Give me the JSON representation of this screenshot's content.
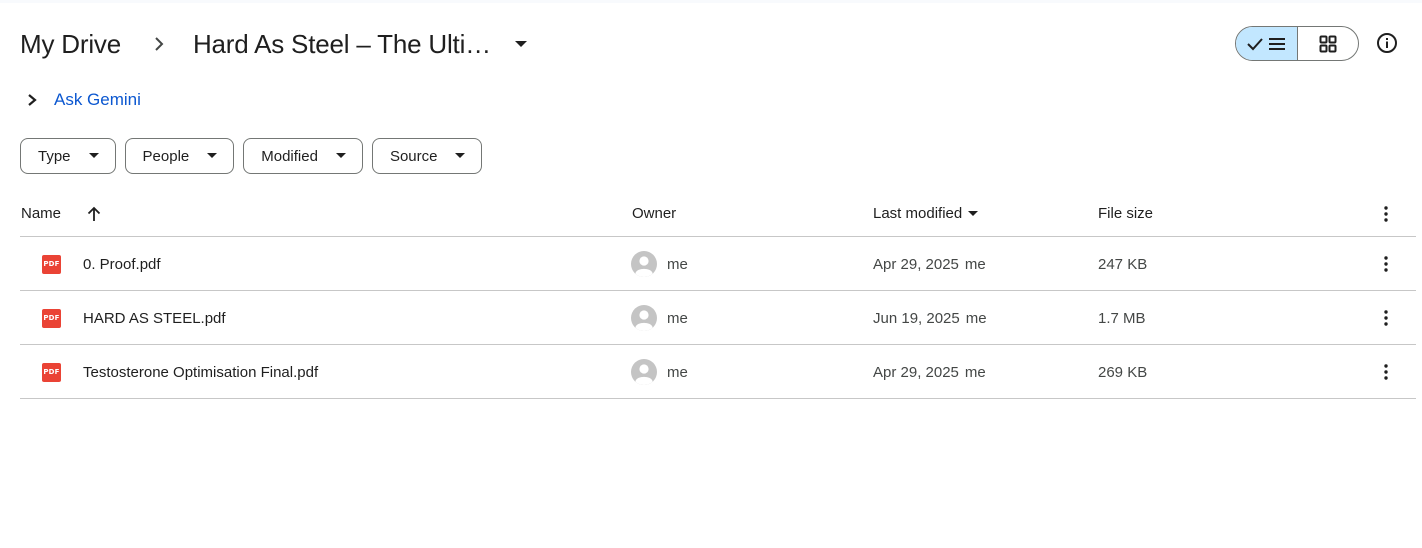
{
  "breadcrumb": {
    "root": "My Drive",
    "current": "Hard As Steel – The Ulti…"
  },
  "view_toggle": {
    "active": "list",
    "options": [
      "list",
      "grid"
    ]
  },
  "gemini": {
    "label": "Ask Gemini"
  },
  "filters": [
    {
      "label": "Type"
    },
    {
      "label": "People"
    },
    {
      "label": "Modified"
    },
    {
      "label": "Source"
    }
  ],
  "table": {
    "columns": {
      "name": "Name",
      "owner": "Owner",
      "modified": "Last modified",
      "size": "File size"
    },
    "sort": {
      "column": "name",
      "direction": "asc"
    },
    "rows": [
      {
        "icon": "pdf-icon",
        "icon_text": "PDF",
        "name": "0. Proof.pdf",
        "owner": "me",
        "modified": "Apr 29, 2025",
        "modified_by": "me",
        "size": "247 KB"
      },
      {
        "icon": "pdf-icon",
        "icon_text": "PDF",
        "name": "HARD AS STEEL.pdf",
        "owner": "me",
        "modified": "Jun 19, 2025",
        "modified_by": "me",
        "size": "1.7 MB"
      },
      {
        "icon": "pdf-icon",
        "icon_text": "PDF",
        "name": "Testosterone Optimisation Final.pdf",
        "owner": "me",
        "modified": "Apr 29, 2025",
        "modified_by": "me",
        "size": "269 KB"
      }
    ]
  },
  "colors": {
    "accent": "#0b57d0",
    "toggle_active": "#c2e7ff",
    "pdf_red": "#ea4335",
    "divider": "#c7c7c7"
  }
}
